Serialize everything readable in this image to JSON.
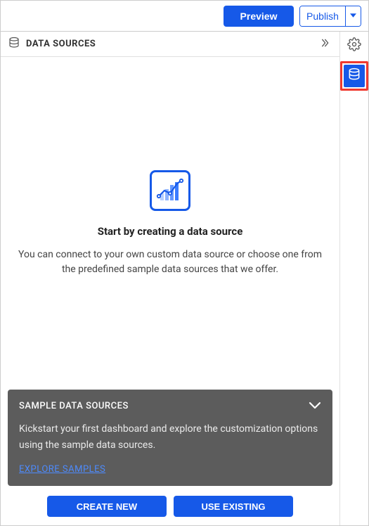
{
  "topbar": {
    "preview_label": "Preview",
    "publish_label": "Publish"
  },
  "panel": {
    "title": "DATA SOURCES"
  },
  "empty_state": {
    "title": "Start by creating a data source",
    "description": "You can connect to your own custom data source or choose one from the predefined sample data sources that we offer."
  },
  "sample_card": {
    "title": "SAMPLE DATA SOURCES",
    "description": "Kickstart your first dashboard and explore the customization options using the sample data sources.",
    "link_label": "EXPLORE SAMPLES"
  },
  "actions": {
    "create_new_label": "CREATE NEW",
    "use_existing_label": "USE EXISTING"
  }
}
